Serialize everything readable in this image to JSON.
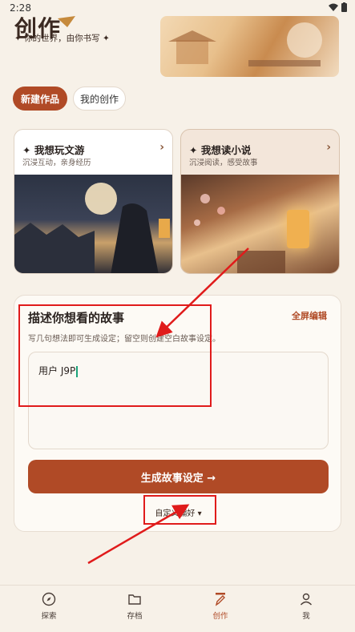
{
  "status": {
    "time": "2:28"
  },
  "header": {
    "logo": "创作",
    "slogan": "✦ 你的世界，由你书写 ✦"
  },
  "tabs": [
    {
      "label": "新建作品"
    },
    {
      "label": "我的创作"
    }
  ],
  "cards": [
    {
      "title": "✦ 我想玩文游",
      "subtitle": "沉浸互动，亲身经历",
      "arrow": "›"
    },
    {
      "title": "✦ 我想读小说",
      "subtitle": "沉浸阅读，感受故事",
      "arrow": "›"
    }
  ],
  "story": {
    "title": "描述你想看的故事",
    "fullscreen": "全屏编辑",
    "hint": "写几句想法即可生成设定；留空则创建空白故事设定。",
    "input_value": "用户 J9P",
    "generate": "生成故事设定 →",
    "custom": "自定义偏好 ▾"
  },
  "nav": [
    {
      "label": "探索",
      "icon": "compass-icon"
    },
    {
      "label": "存档",
      "icon": "folder-icon"
    },
    {
      "label": "创作",
      "icon": "pen-icon"
    },
    {
      "label": "我",
      "icon": "user-icon"
    }
  ],
  "colors": {
    "accent": "#b04a26",
    "annotation": "#e01b1b"
  }
}
